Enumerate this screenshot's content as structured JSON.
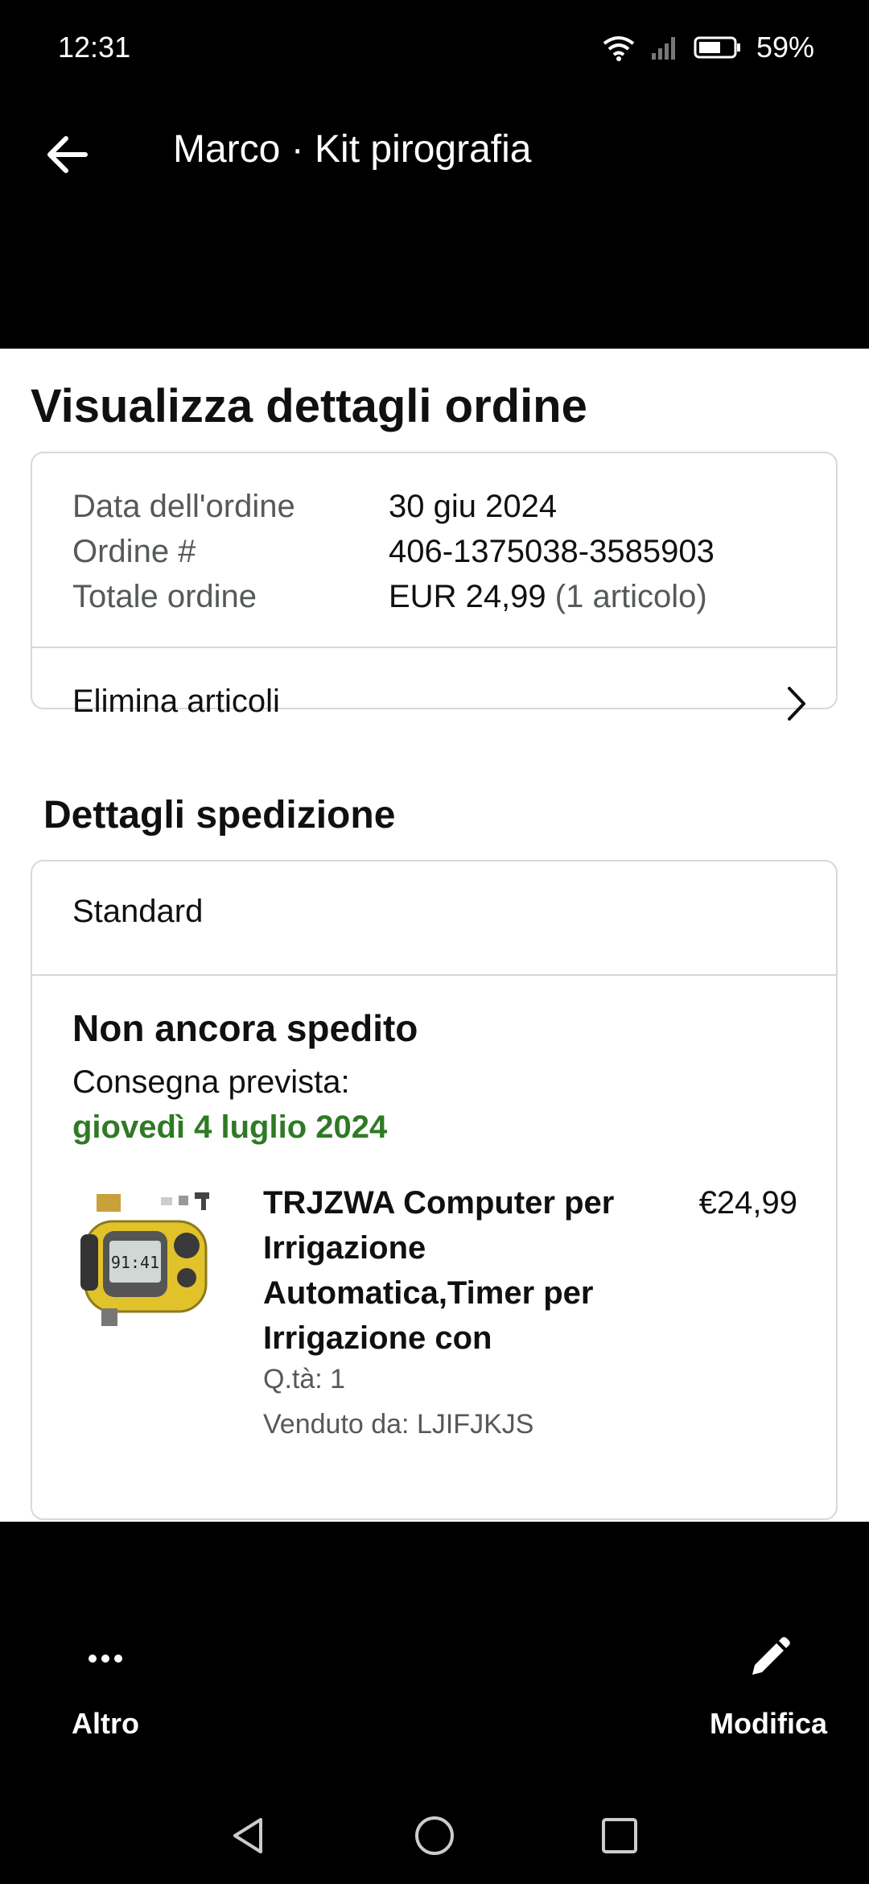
{
  "status_bar": {
    "time": "12:31",
    "battery": "59%"
  },
  "header": {
    "title": "Marco · Kit pirografia"
  },
  "page": {
    "title": "Visualizza dettagli ordine"
  },
  "order": {
    "rows": [
      {
        "label": "Data dell'ordine",
        "value": "30 giu 2024",
        "muted": ""
      },
      {
        "label": "Ordine #",
        "value": "406-1375038-3585903",
        "muted": ""
      },
      {
        "label": "Totale ordine",
        "value": "EUR 24,99",
        "muted": "(1 articolo)"
      }
    ],
    "remove_items_label": "Elimina articoli"
  },
  "shipping": {
    "section_title": "Dettagli spedizione",
    "method": "Standard",
    "status": "Non ancora spedito",
    "delivery_label": "Consegna prevista:",
    "delivery_date": "giovedì 4 luglio 2024",
    "delivery_date_color": "#2f7a25",
    "product": {
      "title": "TRJZWA Computer per Irrigazione Automatica,Timer per Irrigazione con",
      "price": "€24,99",
      "quantity": "Q.tà: 1",
      "seller": "Venduto da: LJIFJKJS",
      "image_icon": "irrigation-timer-image",
      "image_display": "91:41"
    }
  },
  "actions": {
    "more_label": "Altro",
    "more_icon": "more-dots-icon",
    "edit_label": "Modifica",
    "edit_icon": "pencil-icon"
  },
  "nav": {
    "back_icon": "nav-back-icon",
    "home_icon": "nav-home-icon",
    "recents_icon": "nav-recents-icon"
  }
}
